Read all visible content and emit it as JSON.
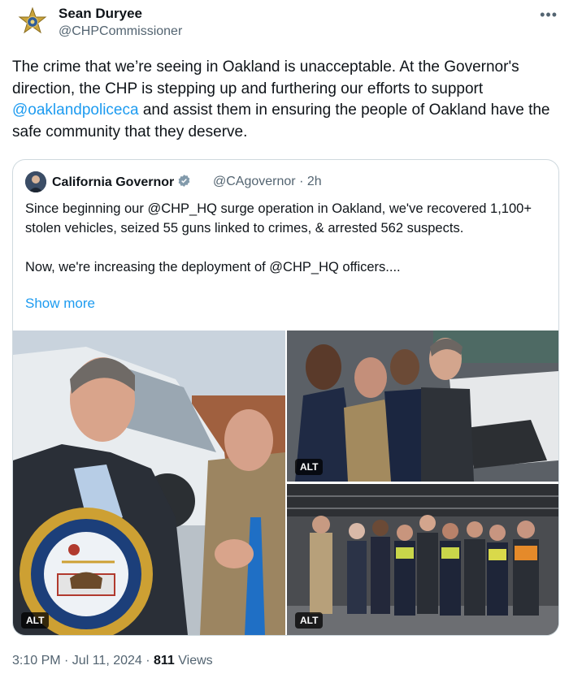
{
  "tweet": {
    "author_name": "Sean Duryee",
    "author_handle": "@CHPCommissioner",
    "more_icon": "•••",
    "text_before": "The crime that we’re seeing in Oakland is unacceptable. At the Governor's direction, the CHP is stepping up and furthering our efforts to support ",
    "mention": "@oaklandpoliceca",
    "text_after": " and assist them in ensuring the people of Oakland have the safe community that they deserve.",
    "timestamp": "3:10 PM · Jul 11, 2024 · ",
    "views_count": "811",
    "views_label": " Views"
  },
  "quote": {
    "author_name": "California Governor",
    "author_handle": "@CAgovernor · 2h",
    "text": "Since beginning our @CHP_HQ surge operation in Oakland, we've recovered 1,100+ stolen vehicles, seized 55 guns linked to crimes, & arrested 562 suspects.\n\nNow, we're increasing the deployment of @CHP_HQ officers....",
    "show_more": "Show more",
    "alt_label": "ALT",
    "seal_text": "GOVERNOR OF THE STATE OF CALIFORNIA"
  },
  "colors": {
    "accent": "#1d9bf0",
    "muted": "#536471",
    "text": "#0f1419"
  }
}
